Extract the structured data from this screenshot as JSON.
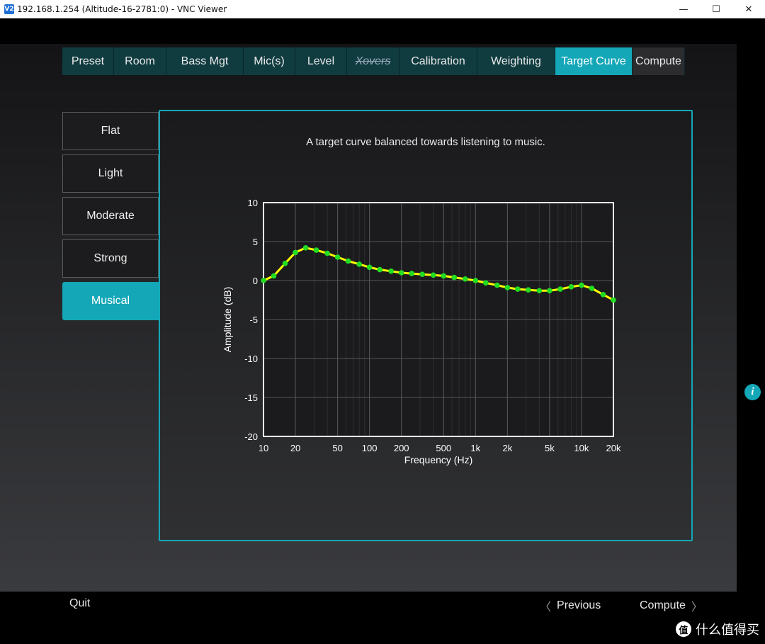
{
  "window": {
    "icon_label": "V2",
    "title": "192.168.1.254 (Altitude-16-2781:0) - VNC Viewer",
    "minimize": "—",
    "maximize": "☐",
    "close": "✕"
  },
  "tabs": [
    {
      "label": "Preset",
      "state": "normal"
    },
    {
      "label": "Room",
      "state": "normal"
    },
    {
      "label": "Bass Mgt",
      "state": "normal"
    },
    {
      "label": "Mic(s)",
      "state": "normal"
    },
    {
      "label": "Level",
      "state": "normal"
    },
    {
      "label": "Xovers",
      "state": "disabled"
    },
    {
      "label": "Calibration",
      "state": "normal"
    },
    {
      "label": "Weighting",
      "state": "normal"
    },
    {
      "label": "Target Curve",
      "state": "active"
    },
    {
      "label": "Compute",
      "state": "dark"
    }
  ],
  "presets": [
    {
      "label": "Flat",
      "active": false
    },
    {
      "label": "Light",
      "active": false
    },
    {
      "label": "Moderate",
      "active": false
    },
    {
      "label": "Strong",
      "active": false
    },
    {
      "label": "Musical",
      "active": true
    }
  ],
  "panel": {
    "description": "A target curve balanced towards listening to music."
  },
  "info_icon": "i",
  "footer": {
    "quit": "Quit",
    "previous": "Previous",
    "previous_chevron": "〈",
    "compute": "Compute",
    "compute_chevron": "〉"
  },
  "watermark": {
    "logo": "值",
    "text": "什么值得买"
  },
  "colors": {
    "accent": "#14a7b8",
    "curve_line": "#ffff00",
    "curve_points": "#22dd22"
  },
  "chart_data": {
    "type": "line",
    "xlabel": "Frequency (Hz)",
    "ylabel": "Amplitude (dB)",
    "x_scale": "log",
    "xlim": [
      10,
      20000
    ],
    "ylim": [
      -20,
      10
    ],
    "grid": true,
    "x_ticks": [
      {
        "value": 10,
        "label": "10"
      },
      {
        "value": 20,
        "label": "20"
      },
      {
        "value": 50,
        "label": "50"
      },
      {
        "value": 100,
        "label": "100"
      },
      {
        "value": 200,
        "label": "200"
      },
      {
        "value": 500,
        "label": "500"
      },
      {
        "value": 1000,
        "label": "1k"
      },
      {
        "value": 2000,
        "label": "2k"
      },
      {
        "value": 5000,
        "label": "5k"
      },
      {
        "value": 10000,
        "label": "10k"
      },
      {
        "value": 20000,
        "label": "20k"
      }
    ],
    "y_ticks": [
      {
        "value": 10,
        "label": "10"
      },
      {
        "value": 5,
        "label": "5"
      },
      {
        "value": 0,
        "label": "0"
      },
      {
        "value": -5,
        "label": "-5"
      },
      {
        "value": -10,
        "label": "-10"
      },
      {
        "value": -15,
        "label": "-15"
      },
      {
        "value": -20,
        "label": "-20"
      }
    ],
    "series": [
      {
        "x": [
          10,
          12.5,
          16,
          20,
          25,
          31.5,
          40,
          50,
          63,
          80,
          100,
          125,
          160,
          200,
          250,
          315,
          400,
          500,
          630,
          800,
          1000,
          1250,
          1600,
          2000,
          2500,
          3150,
          4000,
          5000,
          6300,
          8000,
          10000,
          12500,
          16000,
          20000
        ],
        "y": [
          0,
          0.6,
          2.2,
          3.6,
          4.2,
          3.9,
          3.5,
          3.0,
          2.5,
          2.1,
          1.7,
          1.4,
          1.2,
          1.0,
          0.9,
          0.8,
          0.7,
          0.6,
          0.4,
          0.2,
          0.0,
          -0.3,
          -0.6,
          -0.9,
          -1.1,
          -1.2,
          -1.3,
          -1.3,
          -1.1,
          -0.8,
          -0.6,
          -1.0,
          -1.8,
          -2.5
        ]
      }
    ]
  }
}
